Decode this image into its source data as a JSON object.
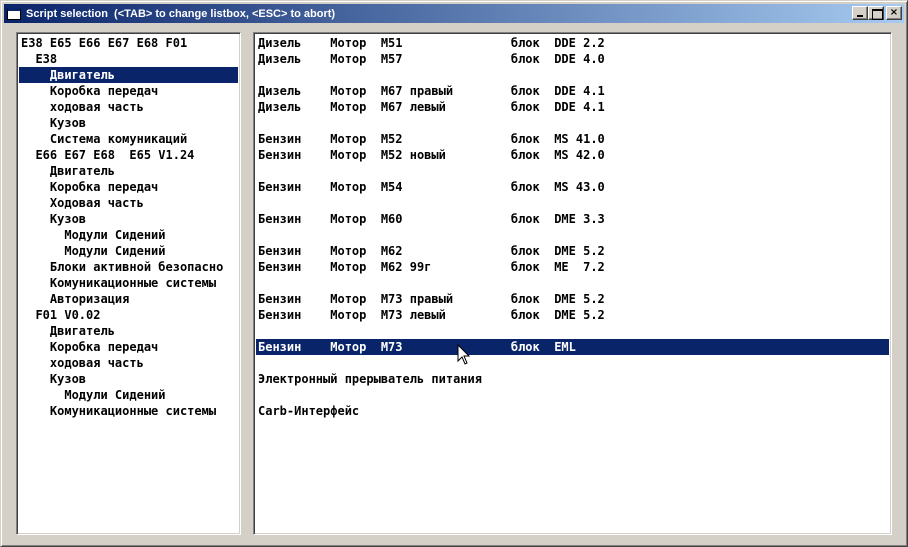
{
  "window": {
    "title": "Script selection  (<TAB> to change listbox, <ESC> to abort)",
    "buttons": {
      "minimize": "_",
      "maximize": "□",
      "close": "×"
    }
  },
  "tree": {
    "items": [
      {
        "label": "E38 E65 E66 E67 E68 F01"
      },
      {
        "label": "  E38"
      },
      {
        "label": "    Двигатель",
        "selected": true
      },
      {
        "label": "    Коробка передач"
      },
      {
        "label": "    ходовая часть"
      },
      {
        "label": "    Кузов"
      },
      {
        "label": "    Система комуникаций"
      },
      {
        "label": "  E66 E67 E68  E65 V1.24"
      },
      {
        "label": "    Двигатель"
      },
      {
        "label": "    Коробка передач"
      },
      {
        "label": "    Ходовая часть"
      },
      {
        "label": "    Кузов"
      },
      {
        "label": "      Модули Сидений"
      },
      {
        "label": "      Модули Сидений"
      },
      {
        "label": "    Блоки активной безопасно"
      },
      {
        "label": "    Комуникационные системы"
      },
      {
        "label": "    Авторизация"
      },
      {
        "label": "  F01 V0.02"
      },
      {
        "label": "    Двигатель"
      },
      {
        "label": "    Коробка передач"
      },
      {
        "label": "    ходовая часть"
      },
      {
        "label": "    Кузов"
      },
      {
        "label": "      Модули Сидений"
      },
      {
        "label": "    Комуникационные системы"
      }
    ]
  },
  "scripts": {
    "items": [
      {
        "label": "Дизель    Мотор  M51               блок  DDE 2.2"
      },
      {
        "label": "Дизель    Мотор  M57               блок  DDE 4.0"
      },
      {
        "label": ""
      },
      {
        "label": "Дизель    Мотор  M67 правый        блок  DDE 4.1"
      },
      {
        "label": "Дизель    Мотор  M67 левый         блок  DDE 4.1"
      },
      {
        "label": ""
      },
      {
        "label": "Бензин    Мотор  M52               блок  MS 41.0"
      },
      {
        "label": "Бензин    Мотор  M52 новый         блок  MS 42.0"
      },
      {
        "label": ""
      },
      {
        "label": "Бензин    Мотор  M54               блок  MS 43.0"
      },
      {
        "label": ""
      },
      {
        "label": "Бензин    Мотор  M60               блок  DME 3.3"
      },
      {
        "label": ""
      },
      {
        "label": "Бензин    Мотор  M62               блок  DME 5.2"
      },
      {
        "label": "Бензин    Мотор  M62 99г           блок  ME  7.2"
      },
      {
        "label": ""
      },
      {
        "label": "Бензин    Мотор  M73 правый        блок  DME 5.2"
      },
      {
        "label": "Бензин    Мотор  M73 левый         блок  DME 5.2"
      },
      {
        "label": ""
      },
      {
        "label": "Бензин    Мотор  M73               блок  EML",
        "selected": true
      },
      {
        "label": ""
      },
      {
        "label": "Электронный прерыватель питания"
      },
      {
        "label": ""
      },
      {
        "label": "Carb-Интерфейс"
      }
    ]
  },
  "colors": {
    "selection": "#0a246a",
    "titlebar_start": "#0a246a",
    "titlebar_end": "#a6caf0",
    "face": "#d4d0c8"
  }
}
